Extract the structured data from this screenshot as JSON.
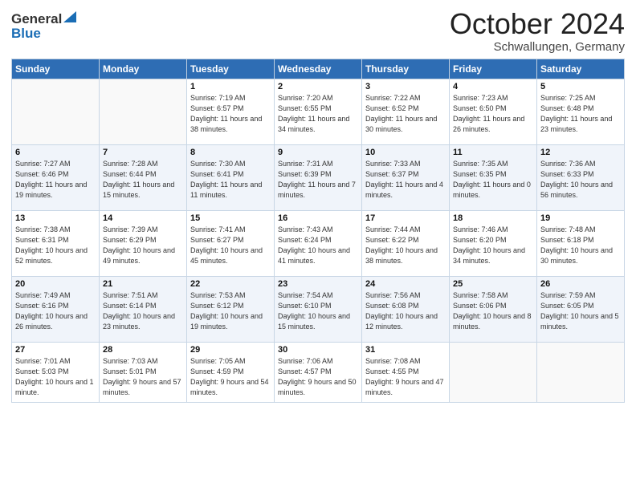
{
  "header": {
    "logo_general": "General",
    "logo_blue": "Blue",
    "title": "October 2024",
    "location": "Schwallungen, Germany"
  },
  "weekdays": [
    "Sunday",
    "Monday",
    "Tuesday",
    "Wednesday",
    "Thursday",
    "Friday",
    "Saturday"
  ],
  "weeks": [
    [
      {
        "day": "",
        "sunrise": "",
        "sunset": "",
        "daylight": ""
      },
      {
        "day": "",
        "sunrise": "",
        "sunset": "",
        "daylight": ""
      },
      {
        "day": "1",
        "sunrise": "Sunrise: 7:19 AM",
        "sunset": "Sunset: 6:57 PM",
        "daylight": "Daylight: 11 hours and 38 minutes."
      },
      {
        "day": "2",
        "sunrise": "Sunrise: 7:20 AM",
        "sunset": "Sunset: 6:55 PM",
        "daylight": "Daylight: 11 hours and 34 minutes."
      },
      {
        "day": "3",
        "sunrise": "Sunrise: 7:22 AM",
        "sunset": "Sunset: 6:52 PM",
        "daylight": "Daylight: 11 hours and 30 minutes."
      },
      {
        "day": "4",
        "sunrise": "Sunrise: 7:23 AM",
        "sunset": "Sunset: 6:50 PM",
        "daylight": "Daylight: 11 hours and 26 minutes."
      },
      {
        "day": "5",
        "sunrise": "Sunrise: 7:25 AM",
        "sunset": "Sunset: 6:48 PM",
        "daylight": "Daylight: 11 hours and 23 minutes."
      }
    ],
    [
      {
        "day": "6",
        "sunrise": "Sunrise: 7:27 AM",
        "sunset": "Sunset: 6:46 PM",
        "daylight": "Daylight: 11 hours and 19 minutes."
      },
      {
        "day": "7",
        "sunrise": "Sunrise: 7:28 AM",
        "sunset": "Sunset: 6:44 PM",
        "daylight": "Daylight: 11 hours and 15 minutes."
      },
      {
        "day": "8",
        "sunrise": "Sunrise: 7:30 AM",
        "sunset": "Sunset: 6:41 PM",
        "daylight": "Daylight: 11 hours and 11 minutes."
      },
      {
        "day": "9",
        "sunrise": "Sunrise: 7:31 AM",
        "sunset": "Sunset: 6:39 PM",
        "daylight": "Daylight: 11 hours and 7 minutes."
      },
      {
        "day": "10",
        "sunrise": "Sunrise: 7:33 AM",
        "sunset": "Sunset: 6:37 PM",
        "daylight": "Daylight: 11 hours and 4 minutes."
      },
      {
        "day": "11",
        "sunrise": "Sunrise: 7:35 AM",
        "sunset": "Sunset: 6:35 PM",
        "daylight": "Daylight: 11 hours and 0 minutes."
      },
      {
        "day": "12",
        "sunrise": "Sunrise: 7:36 AM",
        "sunset": "Sunset: 6:33 PM",
        "daylight": "Daylight: 10 hours and 56 minutes."
      }
    ],
    [
      {
        "day": "13",
        "sunrise": "Sunrise: 7:38 AM",
        "sunset": "Sunset: 6:31 PM",
        "daylight": "Daylight: 10 hours and 52 minutes."
      },
      {
        "day": "14",
        "sunrise": "Sunrise: 7:39 AM",
        "sunset": "Sunset: 6:29 PM",
        "daylight": "Daylight: 10 hours and 49 minutes."
      },
      {
        "day": "15",
        "sunrise": "Sunrise: 7:41 AM",
        "sunset": "Sunset: 6:27 PM",
        "daylight": "Daylight: 10 hours and 45 minutes."
      },
      {
        "day": "16",
        "sunrise": "Sunrise: 7:43 AM",
        "sunset": "Sunset: 6:24 PM",
        "daylight": "Daylight: 10 hours and 41 minutes."
      },
      {
        "day": "17",
        "sunrise": "Sunrise: 7:44 AM",
        "sunset": "Sunset: 6:22 PM",
        "daylight": "Daylight: 10 hours and 38 minutes."
      },
      {
        "day": "18",
        "sunrise": "Sunrise: 7:46 AM",
        "sunset": "Sunset: 6:20 PM",
        "daylight": "Daylight: 10 hours and 34 minutes."
      },
      {
        "day": "19",
        "sunrise": "Sunrise: 7:48 AM",
        "sunset": "Sunset: 6:18 PM",
        "daylight": "Daylight: 10 hours and 30 minutes."
      }
    ],
    [
      {
        "day": "20",
        "sunrise": "Sunrise: 7:49 AM",
        "sunset": "Sunset: 6:16 PM",
        "daylight": "Daylight: 10 hours and 26 minutes."
      },
      {
        "day": "21",
        "sunrise": "Sunrise: 7:51 AM",
        "sunset": "Sunset: 6:14 PM",
        "daylight": "Daylight: 10 hours and 23 minutes."
      },
      {
        "day": "22",
        "sunrise": "Sunrise: 7:53 AM",
        "sunset": "Sunset: 6:12 PM",
        "daylight": "Daylight: 10 hours and 19 minutes."
      },
      {
        "day": "23",
        "sunrise": "Sunrise: 7:54 AM",
        "sunset": "Sunset: 6:10 PM",
        "daylight": "Daylight: 10 hours and 15 minutes."
      },
      {
        "day": "24",
        "sunrise": "Sunrise: 7:56 AM",
        "sunset": "Sunset: 6:08 PM",
        "daylight": "Daylight: 10 hours and 12 minutes."
      },
      {
        "day": "25",
        "sunrise": "Sunrise: 7:58 AM",
        "sunset": "Sunset: 6:06 PM",
        "daylight": "Daylight: 10 hours and 8 minutes."
      },
      {
        "day": "26",
        "sunrise": "Sunrise: 7:59 AM",
        "sunset": "Sunset: 6:05 PM",
        "daylight": "Daylight: 10 hours and 5 minutes."
      }
    ],
    [
      {
        "day": "27",
        "sunrise": "Sunrise: 7:01 AM",
        "sunset": "Sunset: 5:03 PM",
        "daylight": "Daylight: 10 hours and 1 minute."
      },
      {
        "day": "28",
        "sunrise": "Sunrise: 7:03 AM",
        "sunset": "Sunset: 5:01 PM",
        "daylight": "Daylight: 9 hours and 57 minutes."
      },
      {
        "day": "29",
        "sunrise": "Sunrise: 7:05 AM",
        "sunset": "Sunset: 4:59 PM",
        "daylight": "Daylight: 9 hours and 54 minutes."
      },
      {
        "day": "30",
        "sunrise": "Sunrise: 7:06 AM",
        "sunset": "Sunset: 4:57 PM",
        "daylight": "Daylight: 9 hours and 50 minutes."
      },
      {
        "day": "31",
        "sunrise": "Sunrise: 7:08 AM",
        "sunset": "Sunset: 4:55 PM",
        "daylight": "Daylight: 9 hours and 47 minutes."
      },
      {
        "day": "",
        "sunrise": "",
        "sunset": "",
        "daylight": ""
      },
      {
        "day": "",
        "sunrise": "",
        "sunset": "",
        "daylight": ""
      }
    ]
  ]
}
